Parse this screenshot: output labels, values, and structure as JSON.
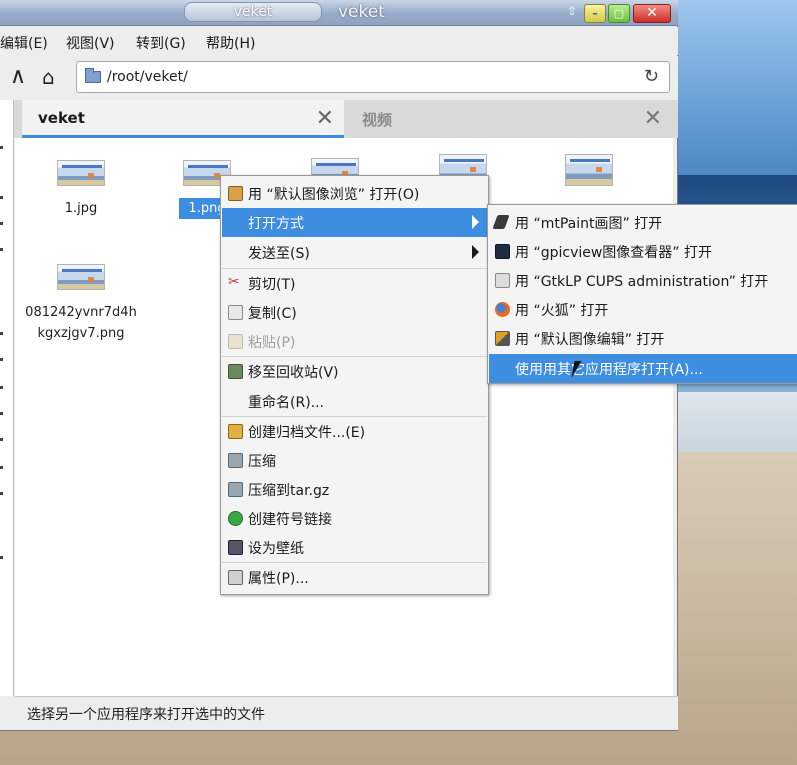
{
  "window": {
    "title_tab": "veket",
    "title": "veket",
    "minimize_glyph": "–",
    "maximize_glyph": "▢",
    "close_glyph": "✕",
    "pin_glyph": "⇧"
  },
  "menubar": [
    "编辑(E)",
    "视图(V)",
    "转到(G)",
    "帮助(H)"
  ],
  "toolbar": {
    "up_icon": "up-arrow-icon",
    "home_icon": "home-icon",
    "path": "/root/veket/",
    "reload_icon": "reload-icon"
  },
  "tabs": [
    {
      "label": "veket",
      "active": true
    },
    {
      "label": "视频",
      "active": false
    }
  ],
  "files": [
    {
      "name": "1.jpg"
    },
    {
      "name": "1.png",
      "selected": true
    },
    {
      "name": ""
    },
    {
      "name": ""
    },
    {
      "name": ""
    },
    {
      "name_line1": "081242yvnr7d4h",
      "name_line2": "kgxzjgv7.png"
    }
  ],
  "context_menu": {
    "items": [
      {
        "label": "用 “默认图像浏览” 打开(O)"
      },
      {
        "label": "打开方式",
        "submenu": true,
        "highlighted": true
      },
      {
        "label": "发送至(S)",
        "submenu": true
      },
      {
        "label": "剪切(T)"
      },
      {
        "label": "复制(C)"
      },
      {
        "label": "粘贴(P)",
        "disabled": true
      },
      {
        "label": "移至回收站(V)"
      },
      {
        "label": "重命名(R)..."
      },
      {
        "label": "创建归档文件...(E)"
      },
      {
        "label": "压缩"
      },
      {
        "label": "压缩到tar.gz"
      },
      {
        "label": "创建符号链接"
      },
      {
        "label": "设为壁纸"
      },
      {
        "label": "属性(P)..."
      }
    ]
  },
  "submenu": {
    "items": [
      {
        "label": "用 “mtPaint画图” 打开"
      },
      {
        "label": "用 “gpicview图像查看器” 打开"
      },
      {
        "label": "用 “GtkLP CUPS administration” 打开"
      },
      {
        "label": "用 “火狐” 打开"
      },
      {
        "label": "用 “默认图像编辑” 打开"
      },
      {
        "label": "使用用其它应用程序打开(A)...",
        "highlighted": true
      }
    ]
  },
  "statusbar": {
    "text": "选择另一个应用程序来打开选中的文件"
  },
  "colors": {
    "accent": "#3d8ee0",
    "menu_bg": "#f4f4f4",
    "window_bg": "#ededed"
  }
}
